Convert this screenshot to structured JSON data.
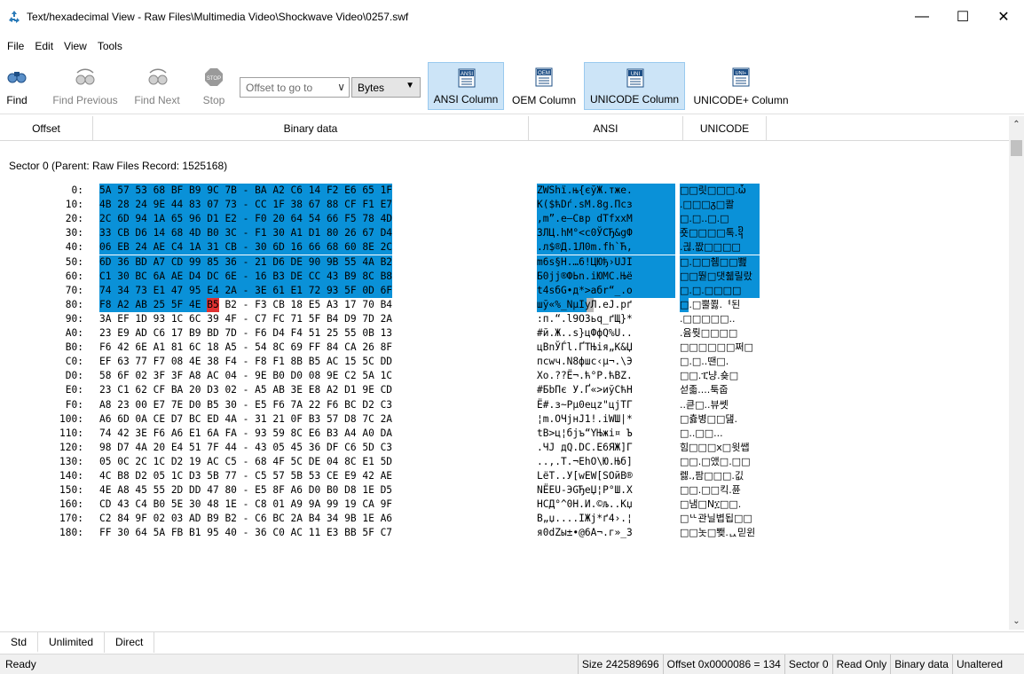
{
  "window": {
    "title": "Text/hexadecimal View - Raw Files\\Multimedia Video\\Shockwave Video\\0257.swf",
    "minimize": "—",
    "maximize": "☐",
    "close": "✕"
  },
  "menu": [
    "File",
    "Edit",
    "View",
    "Tools"
  ],
  "toolbar": {
    "find": "Find",
    "find_previous": "Find Previous",
    "find_next": "Find Next",
    "stop": "Stop",
    "offset_placeholder": "Offset to go to",
    "units": "Bytes",
    "ansi_column": "ANSI Column",
    "oem_column": "OEM Column",
    "unicode_column": "UNICODE Column",
    "unicode_plus_column": "UNICODE+ Column",
    "icon_ansi": "ANSI",
    "icon_oem": "OEM",
    "icon_uni": "UNI",
    "icon_uniplus": "UNI+",
    "icon_stop": "STOP"
  },
  "columns": {
    "offset": "Offset",
    "binary": "Binary data",
    "ansi": "ANSI",
    "unicode": "UNICODE"
  },
  "sector_label": "Sector 0 (Parent: Raw Files Record: 1525168)",
  "rows": [
    {
      "off": "0:",
      "hex": "5A 57 53 68 BF B9 9C 7B - BA A2 C6 14 F2 E6 65 1F",
      "ansi": "ZWShї.њ{єўЖ.тже.",
      "uni": "□□릿□□□.ὧ"
    },
    {
      "off": "10:",
      "hex": "4B 28 24 9E 44 83 07 73 - CC 1F 38 67 88 CF F1 E7",
      "ansi": "K($ћDѓ.sМ.8g.Псз",
      "uni": ".□□□ᵹ□콸"
    },
    {
      "off": "20:",
      "hex": "2C 6D 94 1A 65 96 D1 E2 - F0 20 64 54 66 F5 78 4D",
      "ansi": ",m”.e–Свр dTfхxM",
      "uni": "□.□..□.□"
    },
    {
      "off": "30:",
      "hex": "33 CB D6 14 68 4D B0 3C - F1 30 A1 D1 80 26 67 D4",
      "ansi": "3ЛЦ.hM°<с0ЎСЂ&gФ",
      "uni": "죳□□□□톡.᧦"
    },
    {
      "off": "40:",
      "hex": "06 EB 24 AE C4 1A 31 CB - 30 6D 16 66 68 60 8E 2C",
      "ansi": ".л$®Д.1Л0m.fh`Ћ,",
      "uni": ".긚.짮□□□□"
    },
    {
      "off": "50:",
      "hex": "6D 36 BD A7 CD 99 85 36 - 21 D6 DE 90 9B 55 4A B2",
      "ansi": "m6ѕ§Н.…6!ЦЮђ›UJІ",
      "uni": "□.□□췜□□뾆"
    },
    {
      "off": "60:",
      "hex": "C1 30 BC 6A AE D4 DC 6E - 16 B3 DE CC 43 B9 8C B8",
      "ansi": "Б0јj®ФЬn.іЮМC.Њё",
      "uni": "□□뚿□댓췗릴랐"
    },
    {
      "off": "70:",
      "hex": "74 34 73 E1 47 95 E4 2A - 3E 61 E1 72 93 5F 0D 6F",
      "ansi": "t4sбG•д*>aбr“_.o",
      "uni": "□.□.□□□□"
    },
    {
      "off": "80:",
      "hex": "F8 A2 AB 25 5F 4E B5 B2 - F3 CB 18 E5 A3 17 70 B4",
      "ansi": "шў«%_NµІуЛ.еЈ.pґ",
      "uni": "□.□뿔쬟.ᅧ된"
    },
    {
      "off": "90:",
      "hex": "3A EF 1D 93 1C 6C 39 4F - C7 FC 71 5F B4 D9 7D 2A",
      "ansi": ":п.“.l9OЗьq_ґЩ}*",
      "uni": ".□□□□□.."
    },
    {
      "off": "A0:",
      "hex": "23 E9 AD C6 17 B9 BD 7D - F6 D4 F4 51 25 55 0B 13",
      "ansi": "#й.Ж..ѕ}цФфQ%U..",
      "uni": ".윰뤗□□□□"
    },
    {
      "off": "B0:",
      "hex": "F6 42 6E A1 81 6C 18 A5 - 54 8C 69 FF 84 CA 26 8F",
      "ansi": "цBnЎЃl.ҐTЊiя„К&Џ",
      "uni": "□□□□□□쩌□"
    },
    {
      "off": "C0:",
      "hex": "EF 63 77 F7 08 4E 38 F4 - F8 F1 8B B5 AC 15 5C DD",
      "ansi": "пcwч.N8фшс‹µ¬.\\Э",
      "uni": "□.□..땐□."
    },
    {
      "off": "D0:",
      "hex": "58 6F 02 3F 3F A8 AC 04 - 9E B0 D0 08 9E C2 5A 1C",
      "ansi": "Xo.??Ё¬.ћ°Р.ћВZ.",
      "uni": "□□.ፒ냥.숒□"
    },
    {
      "off": "E0:",
      "hex": "23 C1 62 CF BA 20 D3 02 - A5 AB 3E E8 A2 D1 9E CD",
      "ansi": "#БbПє У.Ґ«>иўСћН",
      "uni": "섣졻....툭줍"
    },
    {
      "off": "F0:",
      "hex": "A8 23 00 E7 7E D0 B5 30 - E5 F6 7A 22 F6 BC D2 C3",
      "ansi": "Ё#.з~Рµ0ецz\"цјТГ",
      "uni": "..큳□..뷰쎗"
    },
    {
      "off": "100:",
      "hex": "A6 6D 0A CE D7 BC ED 4A - 31 21 0F B3 57 D8 7C 2A",
      "ansi": "¦m.ОЧјнJ1!.іWШ|*",
      "uni": "□츓병□□댎."
    },
    {
      "off": "110:",
      "hex": "74 42 3E F6 A6 E1 6A FA - 93 59 8C E6 B3 A4 A0 DA",
      "ansi": "tB>ц¦бjъ“YЊжі¤ Ъ",
      "uni": "□..□□..."
    },
    {
      "off": "120:",
      "hex": "98 D7 4A 20 E4 51 7F 44 - 43 05 45 36 DF C6 5D C3",
      "ansi": ".ЧJ дQ.DC.E6ЯЖ]Г",
      "uni": "힘□□□x□윗쌥"
    },
    {
      "off": "130:",
      "hex": "05 0C 2C 1C D2 19 AC C5 - 68 4F 5C DE 04 8C E1 5D",
      "ansi": "..,.Т.¬ЕhO\\Ю.Њб]",
      "uni": "□□.□앴□.□□"
    },
    {
      "off": "140:",
      "hex": "4C B8 D2 05 1C D3 5B 77 - C5 57 5B 53 CE E9 42 AE",
      "ansi": "LёТ..У[wЕW[SОйB®",
      "uni": "렗.,팜□□□.깂"
    },
    {
      "off": "150:",
      "hex": "4E A8 45 55 2D DD 47 80 - E5 8F A6 D0 B0 D8 1E D5",
      "ansi": "NЁEU-ЭGЂеЏ¦Р°Ш.Х",
      "uni": "□□.□□킥.퓬"
    },
    {
      "off": "160:",
      "hex": "CD 43 C4 B0 5E 30 48 1E - C8 01 A9 9A 99 19 CA 9F",
      "ansi": "НCД°^0H.И.©љ..Кџ",
      "uni": "□냄□N፲□□."
    },
    {
      "off": "170:",
      "hex": "C2 84 9F 02 03 AD B9 B2 - C6 BC 2A B4 34 9B 1E A6",
      "ansi": "В„џ....ІЖј*ґ4›.¦",
      "uni": "□ᄔ관닐볍됩□□"
    },
    {
      "off": "180:",
      "hex": "FF 30 64 5A FB B1 95 40 - 36 C0 AC 11 E3 BB 5F C7",
      "ansi": "я0dZы±•@6А¬.г»_З",
      "uni": "□□놋□뾎.ᇇ믿윈"
    }
  ],
  "tabs": [
    "Std",
    "Unlimited",
    "Direct"
  ],
  "status": {
    "ready": "Ready",
    "size": "Size 242589696",
    "offset": "Offset 0x0000086 = 134",
    "sector": "Sector 0",
    "readonly": "Read Only",
    "mode": "Binary data",
    "state": "Unaltered"
  },
  "colors": {
    "selection": "#0a91d8",
    "cursor": "#e03232",
    "toolbar_selected": "#cce4f7"
  }
}
